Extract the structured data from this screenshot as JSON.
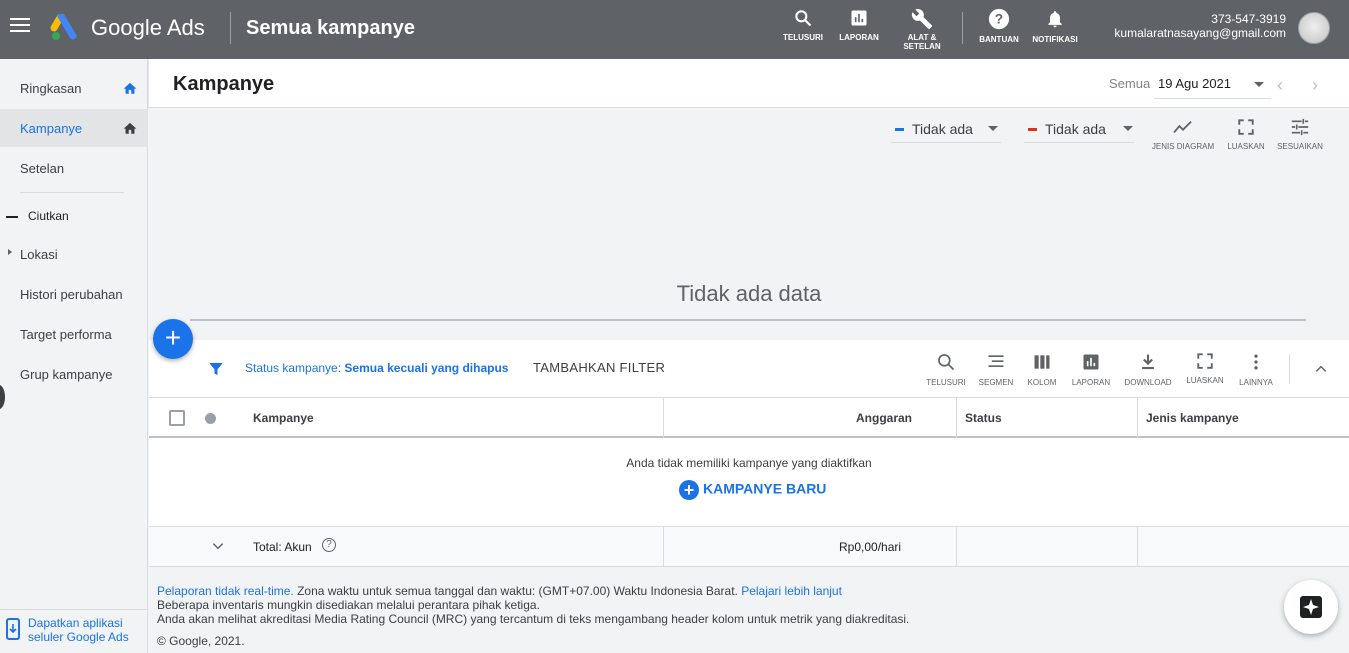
{
  "topbar": {
    "brand": "Google Ads",
    "page_title": "Semua kampanye",
    "buttons": {
      "search": "TELUSURI",
      "reports": "LAPORAN",
      "tools_line1": "ALAT &",
      "tools_line2": "SETELAN",
      "help": "BANTUAN",
      "notifications": "NOTIFIKASI"
    },
    "account_id": "373-547-3919",
    "account_email": "kumalaratnasayang@gmail.com"
  },
  "sidebar": {
    "items": [
      {
        "label": "Ringkasan"
      },
      {
        "label": "Kampanye"
      },
      {
        "label": "Setelan"
      }
    ],
    "collapse_label": "Ciutkan",
    "more_items": [
      {
        "label": "Lokasi"
      },
      {
        "label": "Histori perubahan"
      },
      {
        "label": "Target performa"
      },
      {
        "label": "Grup kampanye"
      }
    ],
    "app_line1": "Dapatkan aplikasi",
    "app_line2": "seluler Google Ads"
  },
  "main": {
    "title": "Kampanye",
    "date_prefix": "Semua",
    "date_value": "19 Agu 2021"
  },
  "chart": {
    "metric1": "Tidak ada",
    "metric2": "Tidak ada",
    "metric1_color": "#1a73e8",
    "metric2_color": "#d93025",
    "tools": {
      "chart_type": "JENIS DIAGRAM",
      "expand": "LUASKAN",
      "customize": "SESUAIKAN"
    },
    "empty_text": "Tidak ada data"
  },
  "filter": {
    "label": "Status kampanye:",
    "value": "Semua kecuali yang dihapus",
    "add_filter": "TAMBAHKAN FILTER",
    "tools": {
      "search": "TELUSURI",
      "segment": "SEGMEN",
      "columns": "KOLOM",
      "reports": "LAPORAN",
      "download": "DOWNLOAD",
      "expand": "LUASKAN",
      "more": "LAINNYA"
    }
  },
  "table": {
    "headers": {
      "campaign": "Kampanye",
      "budget": "Anggaran",
      "status": "Status",
      "type": "Jenis kampanye"
    },
    "empty_message": "Anda tidak memiliki kampanye yang diaktifkan",
    "new_campaign": "KAMPANYE BARU",
    "total_label": "Total: Akun",
    "total_budget": "Rp0,00/hari"
  },
  "footer": {
    "line1_link1": "Pelaporan tidak real-time.",
    "line1_text": " Zona waktu untuk semua tanggal dan waktu: (GMT+07.00) Waktu Indonesia Barat. ",
    "line1_link2": "Pelajari lebih lanjut",
    "line2": "Beberapa inventaris mungkin disediakan melalui perantara pihak ketiga.",
    "line3": "Anda akan melihat akreditasi Media Rating Council (MRC) yang tercantum di teks mengambang header kolom untuk metrik yang diakreditasi.",
    "copyright": "© Google, 2021."
  }
}
